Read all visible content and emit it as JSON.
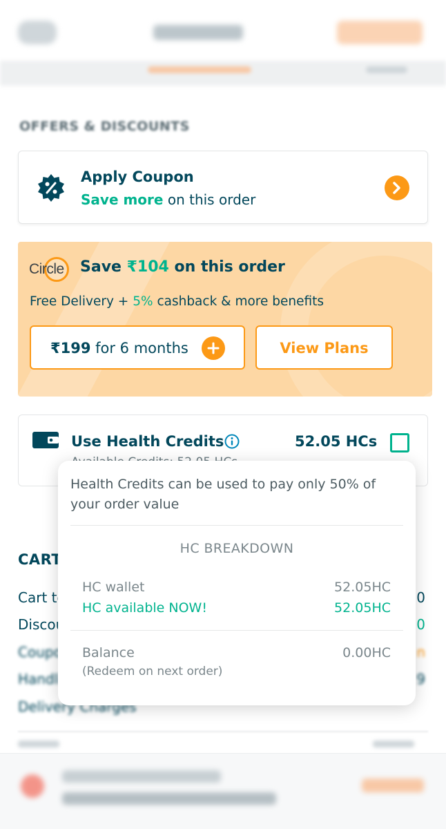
{
  "header": {
    "title": "",
    "action_label": ""
  },
  "offers": {
    "section_title": "OFFERS & DISCOUNTS",
    "coupon": {
      "title": "Apply Coupon",
      "highlight": "Save more",
      "suffix": " on this order"
    }
  },
  "circle": {
    "logo_text": "Circle",
    "save_prefix": "Save ",
    "save_amount": "₹104",
    "save_suffix": " on this order",
    "benefits_prefix": "Free Delivery + ",
    "benefits_pct": "5%",
    "benefits_suffix": " cashback & more benefits",
    "plan_price": "₹199",
    "plan_duration": " for 6 months",
    "view_plans_label": "View Plans"
  },
  "health_credits": {
    "title": "Use Health Credits",
    "amount": "52.05 HCs",
    "available_text": "Available Credits: 52.05 HCs",
    "checked": false
  },
  "cart": {
    "title": "CART",
    "rows": [
      {
        "label": "Cart total",
        "value": "50"
      },
      {
        "label": "Discount",
        "value": "50"
      },
      {
        "label": "Coupon",
        "value": "n"
      },
      {
        "label": "Handling charges",
        "value": "9"
      },
      {
        "label": "Delivery Charges",
        "value": ""
      }
    ]
  },
  "tooltip": {
    "message": "Health Credits can be used to pay only 50% of your order value",
    "breakdown_title": "HC BREAKDOWN",
    "wallet_label": "HC wallet",
    "wallet_value": "52.05HC",
    "available_label": "HC available NOW!",
    "available_value": "52.05HC",
    "balance_label": "Balance",
    "balance_value": "0.00HC",
    "balance_note": "(Redeem on next order)"
  },
  "colors": {
    "primary_text": "#02475b",
    "accent_orange": "#fc9916",
    "accent_green": "#00b38e",
    "circle_bg": "#fdd7a4"
  },
  "icons": [
    "coupon-badge-icon",
    "chevron-right-icon",
    "plus-icon",
    "wallet-icon",
    "info-icon",
    "checkbox-icon"
  ]
}
